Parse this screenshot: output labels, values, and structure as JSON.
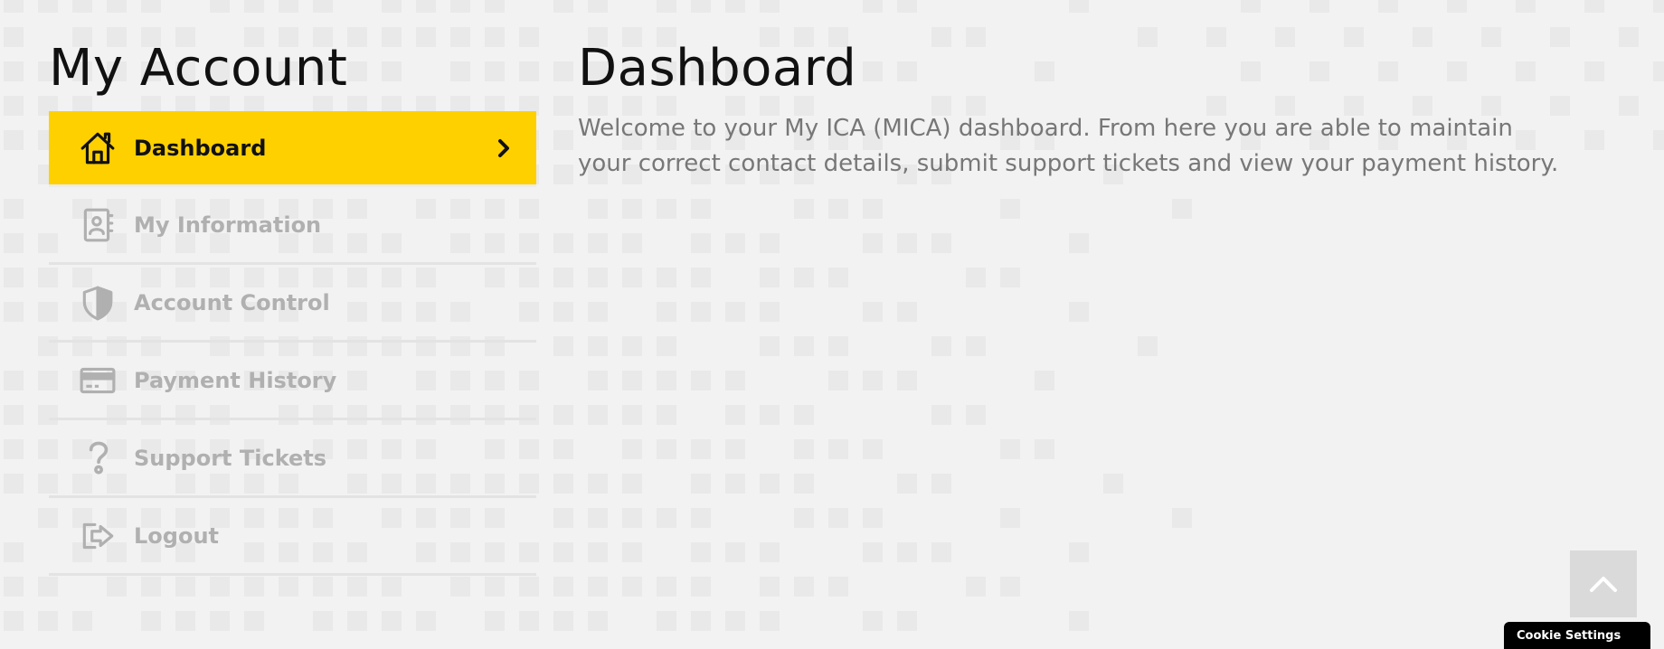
{
  "sidebar": {
    "title": "My Account",
    "items": [
      {
        "label": "Dashboard",
        "icon": "home-icon",
        "active": true
      },
      {
        "label": "My Information",
        "icon": "contact-book-icon",
        "active": false
      },
      {
        "label": "Account Control",
        "icon": "shield-icon",
        "active": false
      },
      {
        "label": "Payment History",
        "icon": "credit-card-icon",
        "active": false
      },
      {
        "label": "Support Tickets",
        "icon": "question-icon",
        "active": false
      },
      {
        "label": "Logout",
        "icon": "logout-icon",
        "active": false
      }
    ]
  },
  "main": {
    "title": "Dashboard",
    "description": "Welcome to your My ICA (MICA) dashboard. From here you are able to maintain your correct contact details, submit support tickets and view your payment history."
  },
  "scroll_top": {
    "icon": "chevron-up-icon"
  },
  "cookie_button": {
    "label": "Cookie Settings"
  },
  "colors": {
    "accent": "#ffd000",
    "background": "#f2f2f2",
    "inactive_text": "#b0b0b0",
    "pattern": "#e9e9e9"
  }
}
